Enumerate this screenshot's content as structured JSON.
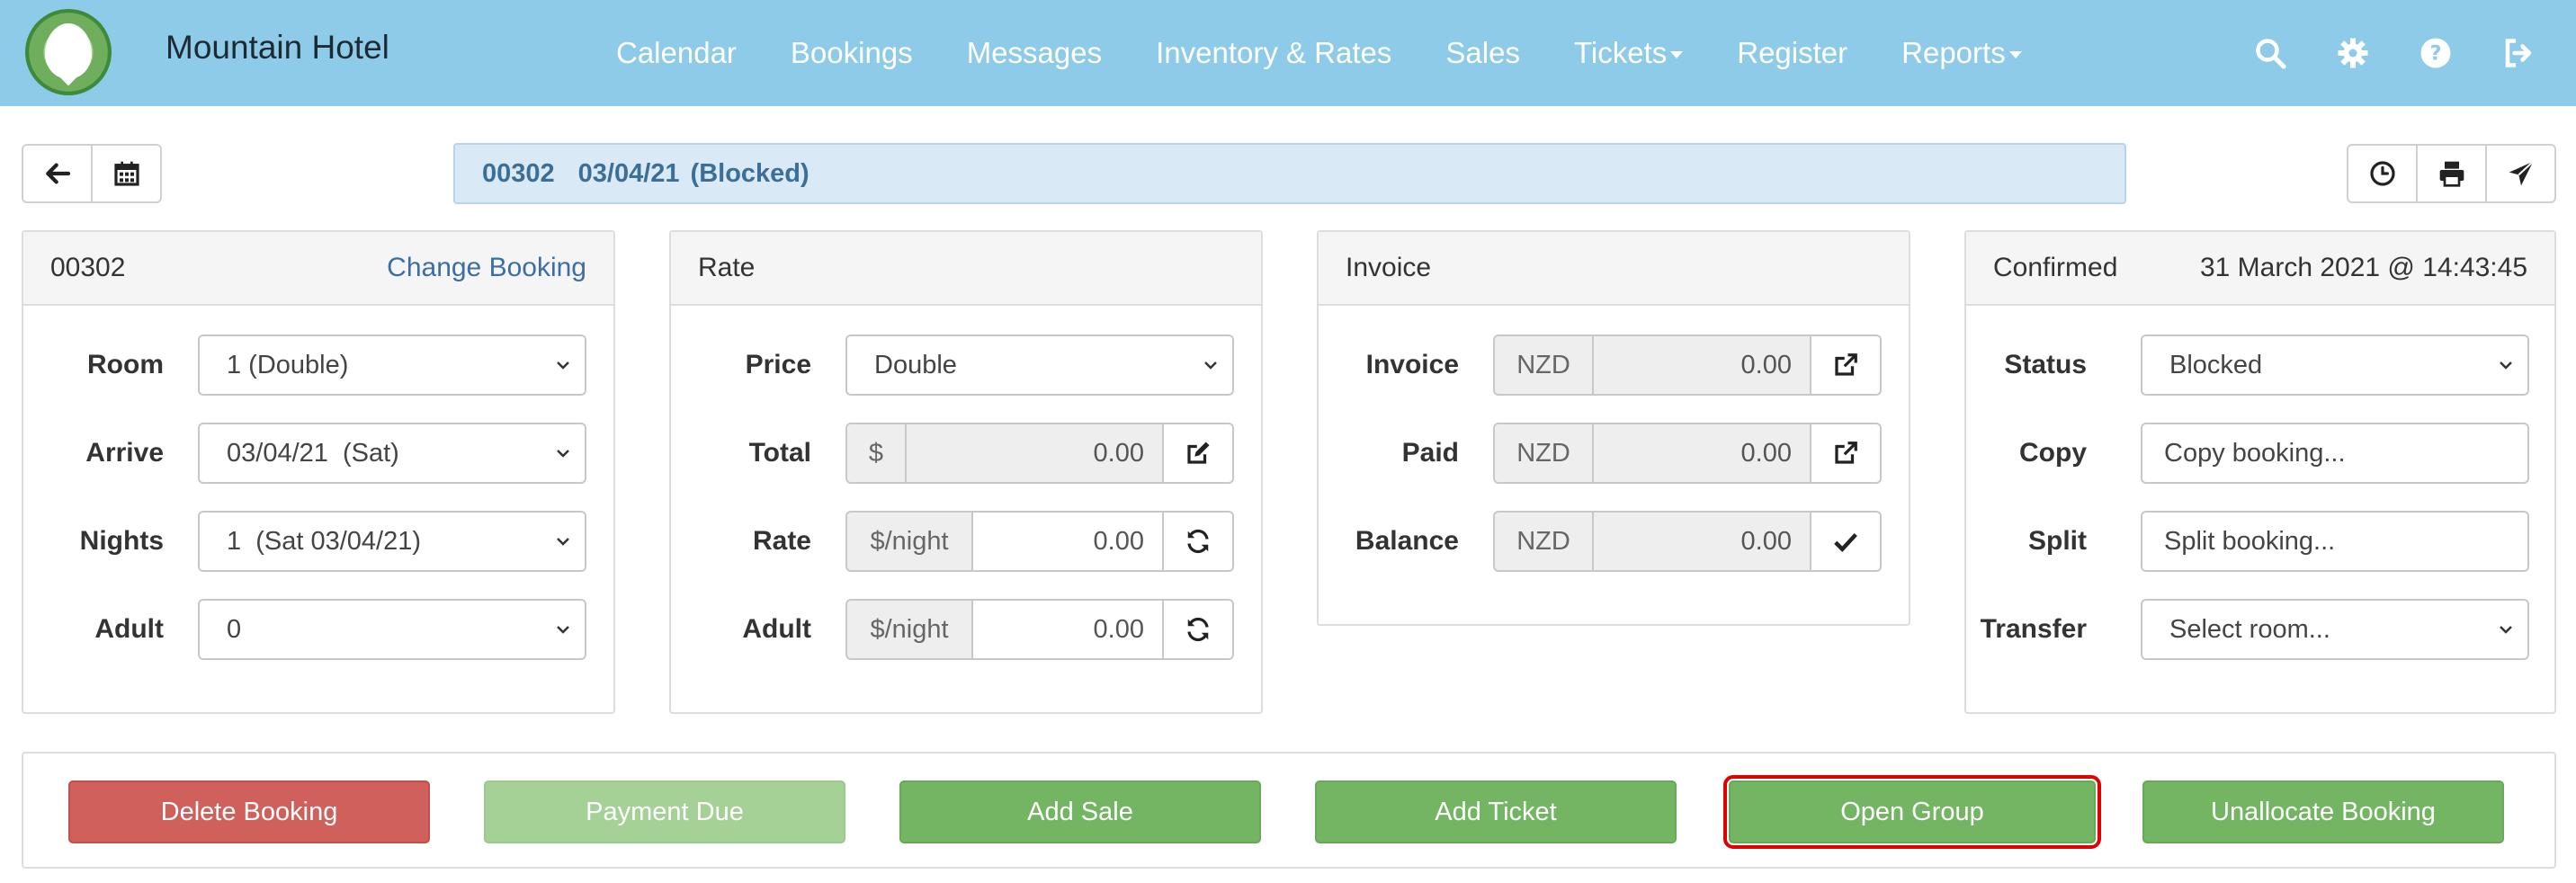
{
  "app": {
    "brand": "Mountain Hotel"
  },
  "nav": {
    "items": [
      {
        "label": "Calendar"
      },
      {
        "label": "Bookings"
      },
      {
        "label": "Messages"
      },
      {
        "label": "Inventory & Rates"
      },
      {
        "label": "Sales"
      },
      {
        "label": "Tickets",
        "dropdown": true
      },
      {
        "label": "Register"
      },
      {
        "label": "Reports",
        "dropdown": true
      }
    ],
    "icons": [
      "search-icon",
      "gear-icon",
      "help-icon",
      "logout-icon"
    ]
  },
  "toolbar": {
    "left_icons": [
      "arrow-left-icon",
      "calendar-icon"
    ],
    "right_icons": [
      "clock-icon",
      "printer-icon",
      "send-icon"
    ],
    "booking_id": "00302",
    "booking_date": "03/04/21",
    "booking_state": "(Blocked)"
  },
  "booking_panel": {
    "title": "00302",
    "change_link": "Change Booking",
    "room_label": "Room",
    "room_value": "1 (Double)",
    "arrive_label": "Arrive",
    "arrive_value": "03/04/21  (Sat)",
    "nights_label": "Nights",
    "nights_value": "1  (Sat 03/04/21)",
    "adult_label": "Adult",
    "adult_value": "0"
  },
  "rate_panel": {
    "title": "Rate",
    "price_label": "Price",
    "price_value": "Double",
    "total_label": "Total",
    "total_currency": "$",
    "total_value": "0.00",
    "rate_label": "Rate",
    "rate_unit": "$/night",
    "rate_value": "0.00",
    "adult_label": "Adult",
    "adult_unit": "$/night",
    "adult_value": "0.00"
  },
  "invoice_panel": {
    "title": "Invoice",
    "invoice_label": "Invoice",
    "invoice_currency": "NZD",
    "invoice_value": "0.00",
    "paid_label": "Paid",
    "paid_currency": "NZD",
    "paid_value": "0.00",
    "balance_label": "Balance",
    "balance_currency": "NZD",
    "balance_value": "0.00"
  },
  "status_panel": {
    "title": "Confirmed",
    "timestamp": "31 March 2021 @ 14:43:45",
    "status_label": "Status",
    "status_value": "Blocked",
    "copy_label": "Copy",
    "copy_value": "Copy booking...",
    "split_label": "Split",
    "split_value": "Split booking...",
    "transfer_label": "Transfer",
    "transfer_value": "Select room..."
  },
  "actions": {
    "delete": "Delete Booking",
    "payment_due": "Payment Due",
    "add_sale": "Add Sale",
    "add_ticket": "Add Ticket",
    "open_group": "Open Group",
    "unallocate": "Unallocate Booking"
  },
  "colors": {
    "navbar": "#8ecbe8",
    "danger": "#d0605b",
    "success": "#73b563",
    "success_light": "#a5d096",
    "highlight": "#e00000",
    "link": "#3a6ea5"
  }
}
